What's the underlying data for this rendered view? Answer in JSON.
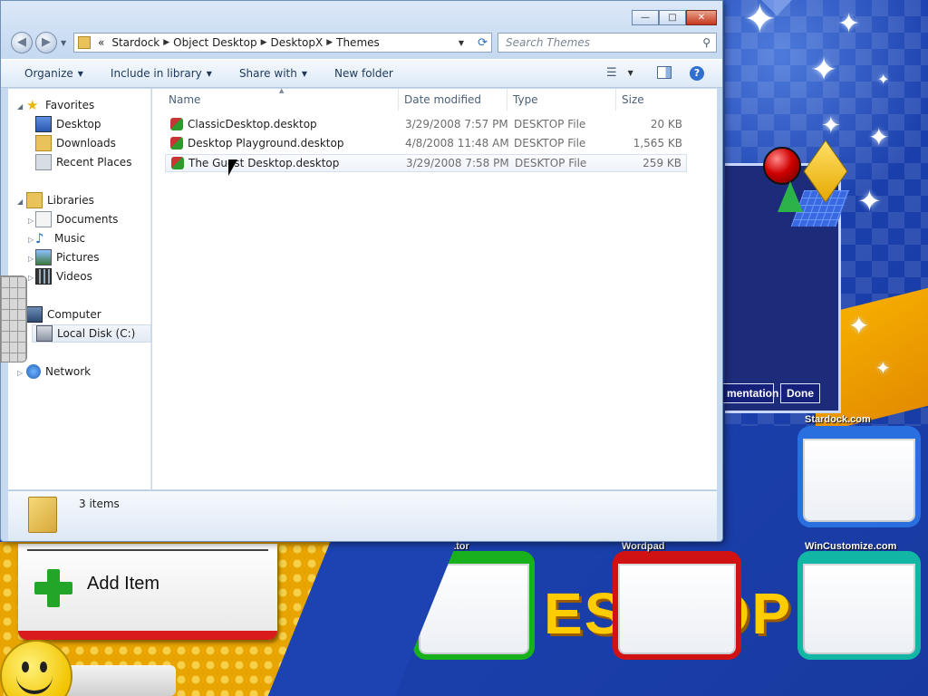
{
  "window": {
    "title_buttons": {
      "minimize": "—",
      "maximize": "□",
      "close": "✕"
    },
    "address": {
      "prefix": "«",
      "segments": [
        "Stardock",
        "Object Desktop",
        "DesktopX",
        "Themes"
      ]
    },
    "search_placeholder": "Search Themes",
    "toolbar": {
      "organize": "Organize",
      "include_in_library": "Include in library",
      "share_with": "Share with",
      "new_folder": "New folder"
    },
    "nav": {
      "favorites": "Favorites",
      "desktop": "Desktop",
      "downloads": "Downloads",
      "recent_places": "Recent Places",
      "libraries": "Libraries",
      "documents": "Documents",
      "music": "Music",
      "pictures": "Pictures",
      "videos": "Videos",
      "computer": "Computer",
      "local_disk": "Local Disk (C:)",
      "network": "Network"
    },
    "columns": {
      "name": "Name",
      "date": "Date modified",
      "type": "Type",
      "size": "Size"
    },
    "files": [
      {
        "name": "ClassicDesktop.desktop",
        "date": "3/29/2008 7:57 PM",
        "type": "DESKTOP File",
        "size": "20 KB"
      },
      {
        "name": "Desktop Playground.desktop",
        "date": "4/8/2008 11:48 AM",
        "type": "DESKTOP File",
        "size": "1,565 KB"
      },
      {
        "name": "The Guest Desktop.desktop",
        "date": "3/29/2008 7:58 PM",
        "type": "DESKTOP File",
        "size": "259 KB"
      }
    ],
    "status": "3 items"
  },
  "desktop": {
    "buttons": {
      "documentation": "mentation",
      "done": "Done"
    },
    "tiles": {
      "stardock": "Stardock.com",
      "calculator": "Calculator",
      "wordpad": "Wordpad",
      "wincustomize": "WinCustomize.com"
    },
    "add_item": "Add Item",
    "logo_text": "ESKTOP"
  },
  "colors": {
    "desktop_blue": "#1c43b4",
    "tile_green": "#19b01e",
    "tile_red": "#d01212",
    "tile_teal": "#12b6a4",
    "tile_blue": "#2a6fe0",
    "add_red": "#d81c1c"
  }
}
